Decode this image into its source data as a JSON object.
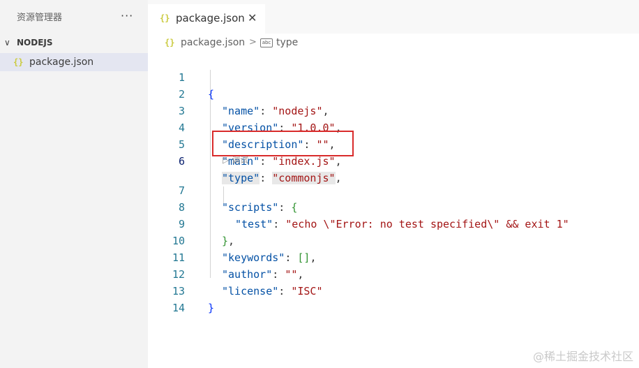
{
  "sidebar": {
    "title": "资源管理器",
    "more": "···",
    "section": {
      "chevron": "∨",
      "label": "NODEJS"
    },
    "file": {
      "icon": "{}",
      "name": "package.json"
    }
  },
  "tab": {
    "icon": "{}",
    "name": "package.json",
    "close": "✕"
  },
  "breadcrumb": {
    "icon": "{}",
    "file": "package.json",
    "sep": ">",
    "symbol_icon": "abc",
    "symbol": "type"
  },
  "editor": {
    "active_line": 6,
    "codelens": {
      "icon": "▷",
      "label": "调试"
    },
    "lines": [
      {
        "n": "1"
      },
      {
        "n": "2"
      },
      {
        "n": "3"
      },
      {
        "n": "4"
      },
      {
        "n": "5"
      },
      {
        "n": "6"
      },
      {
        "n": "7"
      },
      {
        "n": "8"
      },
      {
        "n": "9"
      },
      {
        "n": "10"
      },
      {
        "n": "11"
      },
      {
        "n": "12"
      },
      {
        "n": "13"
      },
      {
        "n": "14"
      }
    ],
    "tokens": {
      "l1": [
        "{"
      ],
      "l2": [
        "\"name\"",
        ": ",
        "\"nodejs\"",
        ","
      ],
      "l3": [
        "\"version\"",
        ": ",
        "\"1.0.0\"",
        ","
      ],
      "l4": [
        "\"description\"",
        ": ",
        "\"\"",
        ","
      ],
      "l5": [
        "\"main\"",
        ": ",
        "\"index.js\"",
        ","
      ],
      "l6": [
        "\"type\"",
        ": ",
        "\"commonjs\"",
        ","
      ],
      "l7": [
        "\"scripts\"",
        ": ",
        "{"
      ],
      "l8": [
        "\"test\"",
        ": ",
        "\"echo \\\"Error: no test specified\\\" && exit 1\""
      ],
      "l9": [
        "}",
        ","
      ],
      "l10": [
        "\"keywords\"",
        ": ",
        "[]",
        ","
      ],
      "l11": [
        "\"author\"",
        ": ",
        "\"\"",
        ","
      ],
      "l12": [
        "\"license\"",
        ": ",
        "\"ISC\""
      ],
      "l13": [
        "}"
      ]
    }
  },
  "colors": {
    "key": "#0451a5",
    "string": "#a31515",
    "brace": "#0431fa",
    "highlight_box": "#d92b2b"
  },
  "watermark": "@稀土掘金技术社区"
}
